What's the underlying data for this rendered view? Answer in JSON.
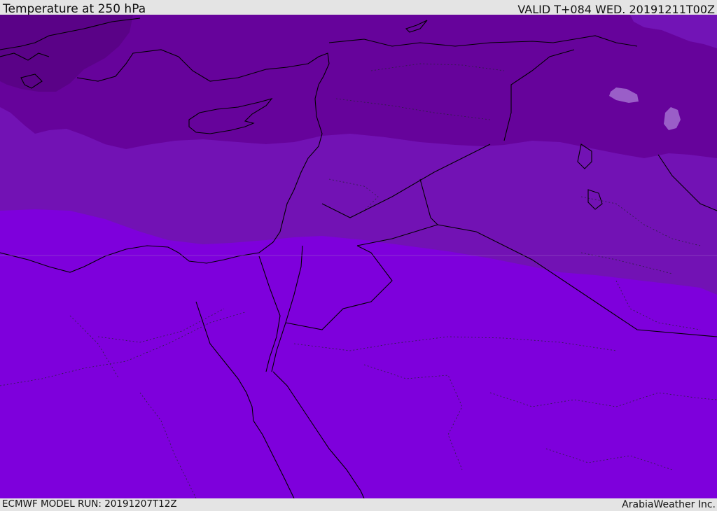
{
  "header": {
    "title": "Temperature at 250 hPa",
    "valid_time": "VALID T+084 WED. 20191211T00Z"
  },
  "footer": {
    "model_run": "ECMWF MODEL RUN: 20191207T12Z",
    "credit": "ArabiaWeather Inc."
  },
  "colors": {
    "band_north": "#66039b",
    "band_middle": "#7212b4",
    "band_south": "#7e00dc",
    "band_northwest": "#5a0287",
    "band_northeast": "#7214b6",
    "coastline": "#000000",
    "border": "#2a2040"
  }
}
